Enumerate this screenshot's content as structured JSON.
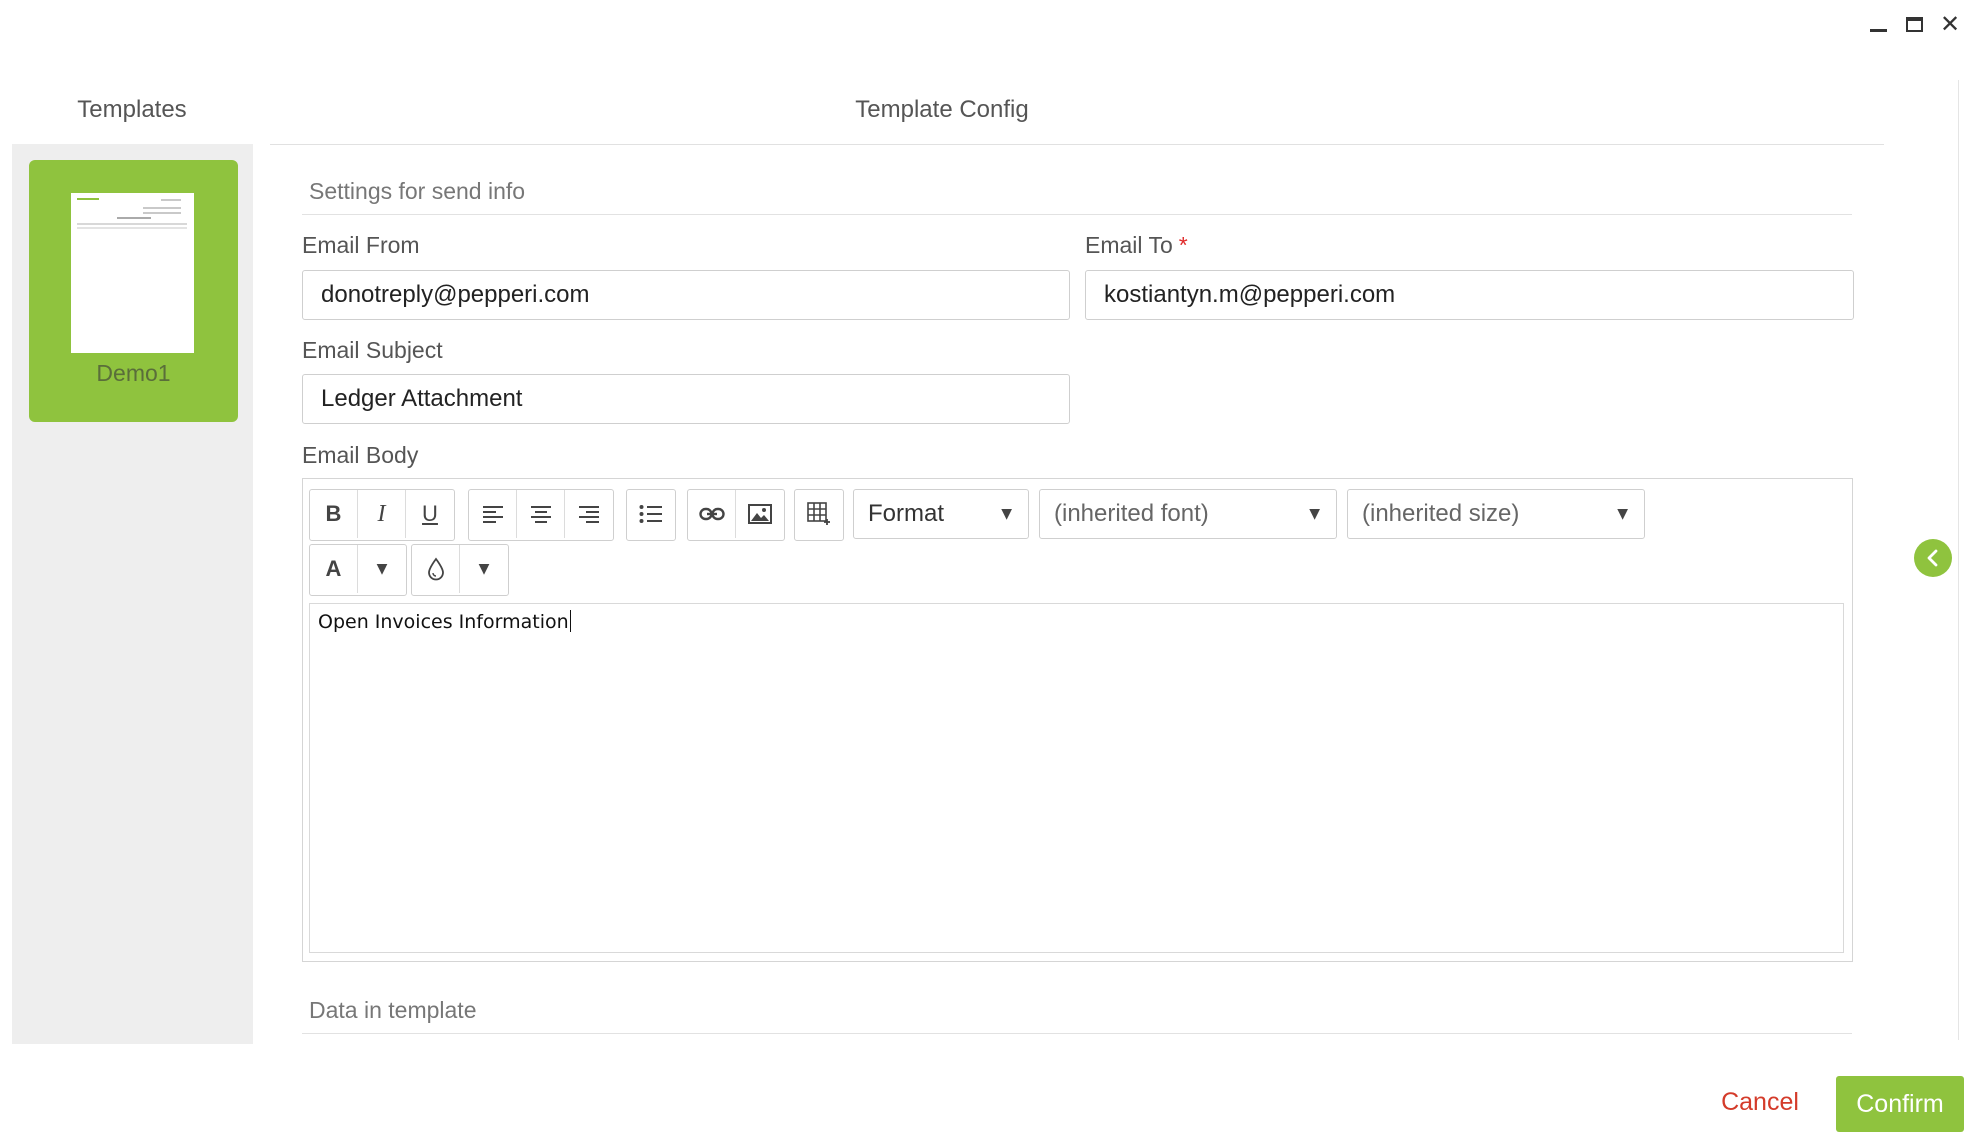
{
  "window_controls": {
    "minimize_icon": "minimize-icon",
    "maximize_icon": "maximize-icon",
    "close_icon": "close-icon"
  },
  "templates_panel": {
    "title": "Templates",
    "items": [
      {
        "name": "Demo1",
        "selected": true
      }
    ]
  },
  "config": {
    "title": "Template Config",
    "send_info_section": "Settings for send info",
    "email_from": {
      "label": "Email From",
      "value": "donotreply@pepperi.com"
    },
    "email_to": {
      "label": "Email To",
      "required_mark": "*",
      "value": "kostiantyn.m@pepperi.com"
    },
    "email_subject": {
      "label": "Email Subject",
      "value": "Ledger Attachment"
    },
    "email_body": {
      "label": "Email Body",
      "toolbar": {
        "bold": "B",
        "italic": "I",
        "underline": "U",
        "format_select": "Format",
        "font_select": "(inherited font)",
        "size_select": "(inherited size)",
        "text_color": "A"
      },
      "content": "Open Invoices Information"
    },
    "data_section": "Data in template"
  },
  "footer": {
    "cancel": "Cancel",
    "confirm": "Confirm"
  },
  "colors": {
    "accent": "#8fc33e",
    "cancel": "#d43b2a",
    "required": "#e02a2a"
  }
}
